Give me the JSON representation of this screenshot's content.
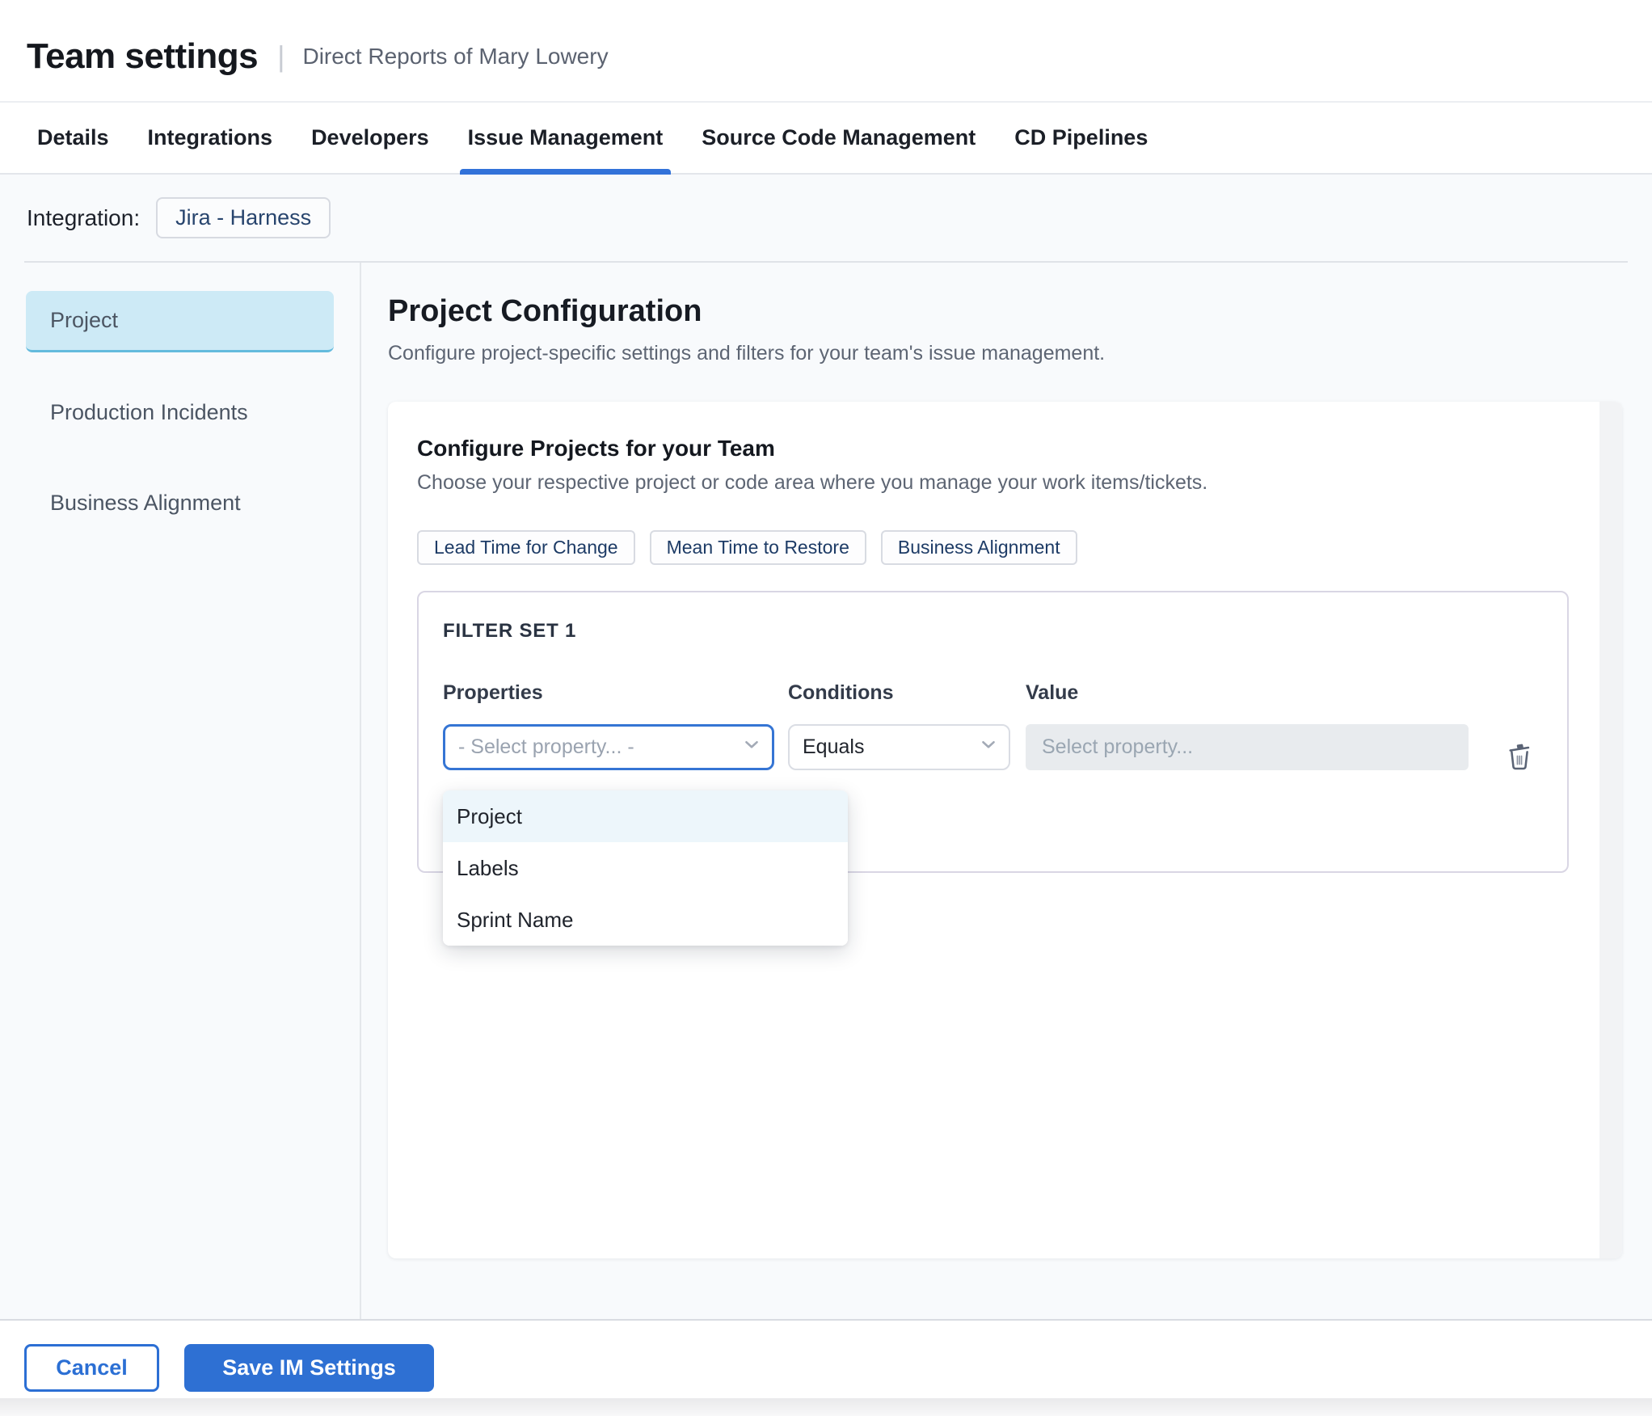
{
  "header": {
    "title": "Team settings",
    "subtitle": "Direct Reports of Mary Lowery"
  },
  "tabs": [
    {
      "label": "Details",
      "active": false
    },
    {
      "label": "Integrations",
      "active": false
    },
    {
      "label": "Developers",
      "active": false
    },
    {
      "label": "Issue Management",
      "active": true
    },
    {
      "label": "Source Code Management",
      "active": false
    },
    {
      "label": "CD Pipelines",
      "active": false
    }
  ],
  "integration": {
    "label": "Integration:",
    "chip": "Jira - Harness"
  },
  "sidebar": {
    "items": [
      {
        "label": "Project",
        "selected": true
      },
      {
        "label": "Production Incidents",
        "selected": false
      },
      {
        "label": "Business Alignment",
        "selected": false
      }
    ]
  },
  "main": {
    "title": "Project Configuration",
    "subtitle": "Configure project-specific settings and filters for your team's issue management.",
    "card": {
      "title": "Configure Projects for your Team",
      "subtitle": "Choose your respective project or code area where you manage your work items/tickets.",
      "chips": [
        {
          "label": "Lead Time for Change"
        },
        {
          "label": "Mean Time to Restore"
        },
        {
          "label": "Business Alignment"
        }
      ],
      "filter_set": {
        "title": "FILTER SET 1",
        "columns": {
          "properties": "Properties",
          "conditions": "Conditions",
          "value": "Value"
        },
        "property_placeholder": "- Select property... -",
        "condition_selected": "Equals",
        "value_placeholder": "Select property...",
        "dropdown_options": [
          {
            "label": "Project",
            "highlighted": true
          },
          {
            "label": "Labels",
            "highlighted": false
          },
          {
            "label": "Sprint Name",
            "highlighted": false
          }
        ]
      }
    }
  },
  "footer": {
    "cancel_label": "Cancel",
    "save_label": "Save IM Settings"
  },
  "colors": {
    "accent_blue": "#2e70d3",
    "tab_underline": "#3272d9",
    "focused_select_border": "#3575d4",
    "selected_sidebar_bg": "#cdeaf6",
    "selected_sidebar_border": "#64bbdd",
    "dropdown_highlight_bg": "#edf6fb",
    "chip_text_navy": "#1d3b66",
    "page_bg": "#f8fafc",
    "disabled_input_bg": "#e8ebee"
  }
}
